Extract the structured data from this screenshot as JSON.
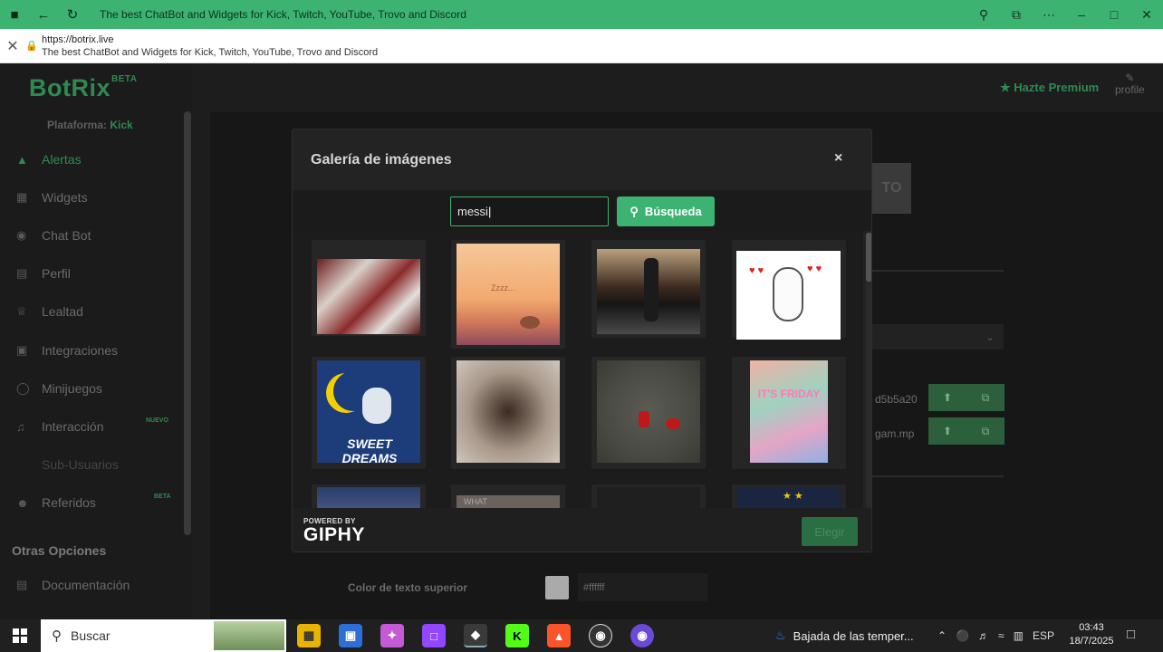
{
  "browser": {
    "title": "The best ChatBot and Widgets for Kick, Twitch, YouTube, Trovo and Discord",
    "url": "https://botrix.live",
    "page_title": "The best ChatBot and Widgets for Kick, Twitch, YouTube, Trovo and Discord"
  },
  "sidebar": {
    "logo": "BotRix",
    "logo_badge": "BETA",
    "platform_label": "Plataforma:",
    "platform_value": "Kick",
    "items": [
      {
        "label": "Alertas",
        "icon": "warning-icon"
      },
      {
        "label": "Widgets",
        "icon": "grid-icon"
      },
      {
        "label": "Chat Bot",
        "icon": "robot-icon"
      },
      {
        "label": "Perfil",
        "icon": "id-card-icon"
      },
      {
        "label": "Lealtad",
        "icon": "trophy-icon"
      },
      {
        "label": "Integraciones",
        "icon": "integrations-icon"
      },
      {
        "label": "Minijuegos",
        "icon": "gamepad-icon"
      },
      {
        "label": "Interacción",
        "icon": "music-icon",
        "badge": "NUEVO"
      },
      {
        "label": "Sub-Usuarios",
        "icon": "none"
      },
      {
        "label": "Referidos",
        "icon": "users-icon",
        "badge": "BETA"
      }
    ],
    "section_other": "Otras Opciones",
    "doc_item": "Documentación"
  },
  "header": {
    "premium": "Hazte Premium",
    "profile": "profile"
  },
  "background": {
    "hash_1": "d5b5a20",
    "file_2": "gam.mp",
    "color_label": "Color de texto superior",
    "color_value": "#ffffff",
    "color_swatch": "#aaaaaa"
  },
  "modal": {
    "title": "Galería de imágenes",
    "close": "×",
    "search_value": "messi",
    "search_button": "Búsqueda",
    "powered_by": "POWERED BY",
    "giphy": "GIPHY",
    "choose_button": "Elegir",
    "gifs": [
      {
        "desc": "stadium crowd celebrating"
      },
      {
        "desc": "Zzzz... sleeping at sunset",
        "caption": "Zzzz..."
      },
      {
        "desc": "player walking on grid"
      },
      {
        "desc": "bunny with hearts"
      },
      {
        "desc": "Sweet Dreams moon",
        "caption": "SWEET DREAMS"
      },
      {
        "desc": "alpaca closeup"
      },
      {
        "desc": "small toy figure"
      },
      {
        "desc": "It's Friday neon",
        "caption": "IT'S FRIDAY"
      },
      {
        "desc": "people in crowd"
      },
      {
        "desc": "What text",
        "caption": "WHAT"
      },
      {
        "desc": "dark frame"
      },
      {
        "desc": "night sky stars"
      }
    ]
  },
  "taskbar": {
    "search_placeholder": "Buscar",
    "weather": "Bajada de las temper...",
    "lang": "ESP",
    "time": "03:43",
    "date": "18/7/2025"
  }
}
